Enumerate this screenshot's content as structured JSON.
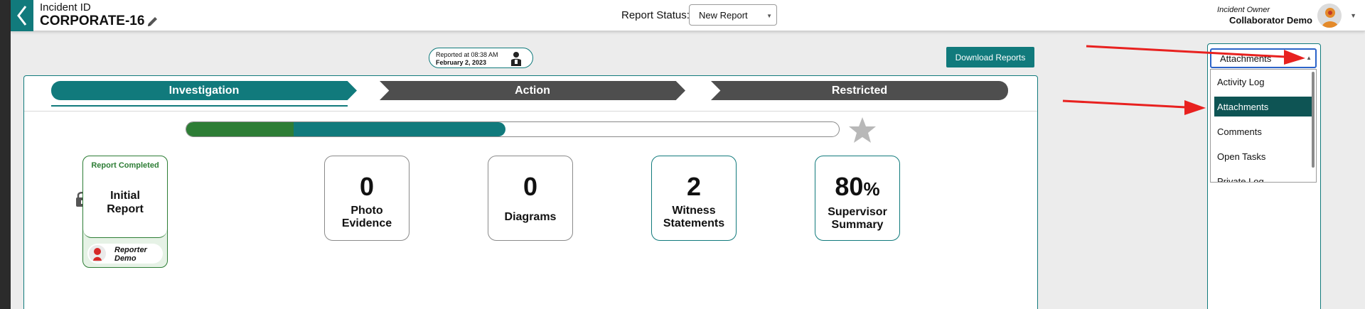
{
  "header": {
    "incident_label": "Incident ID",
    "incident_id": "CORPORATE-16",
    "report_status_label": "Report Status:",
    "report_status_value": "New Report",
    "owner_label": "Incident Owner",
    "owner_name": "Collaborator Demo"
  },
  "reported": {
    "time_text": "Reported at 08:38 AM",
    "date_text": "February 2, 2023"
  },
  "download_label": "Download Reports",
  "tabs": [
    {
      "label": "Investigation",
      "active": true
    },
    {
      "label": "Action",
      "active": false
    },
    {
      "label": "Restricted",
      "active": false
    }
  ],
  "progress": {
    "green_fraction": 0.165,
    "teal_fraction": 0.325
  },
  "initial_report": {
    "status": "Report Completed",
    "title_line1": "Initial",
    "title_line2": "Report",
    "reporter_line1": "Reporter",
    "reporter_line2": "Demo"
  },
  "stats": [
    {
      "value": "0",
      "label_line1": "Photo",
      "label_line2": "Evidence",
      "style": "grey"
    },
    {
      "value": "0",
      "label_line1": "Diagrams",
      "label_line2": "",
      "style": "grey"
    },
    {
      "value": "2",
      "label_line1": "Witness",
      "label_line2": "Statements",
      "style": "teal"
    },
    {
      "value": "80",
      "suffix": "%",
      "label_line1": "Supervisor",
      "label_line2": "Summary",
      "style": "teal"
    }
  ],
  "dropdown": {
    "selected": "Attachments",
    "options": [
      "Activity Log",
      "Attachments",
      "Comments",
      "Open Tasks",
      "Private Log"
    ]
  },
  "colors": {
    "teal": "#117a7c",
    "green": "#2d7d35",
    "dark_tab": "#4e4e4e",
    "selected_option": "#0e5454",
    "annotation_arrow": "#e8211f"
  }
}
